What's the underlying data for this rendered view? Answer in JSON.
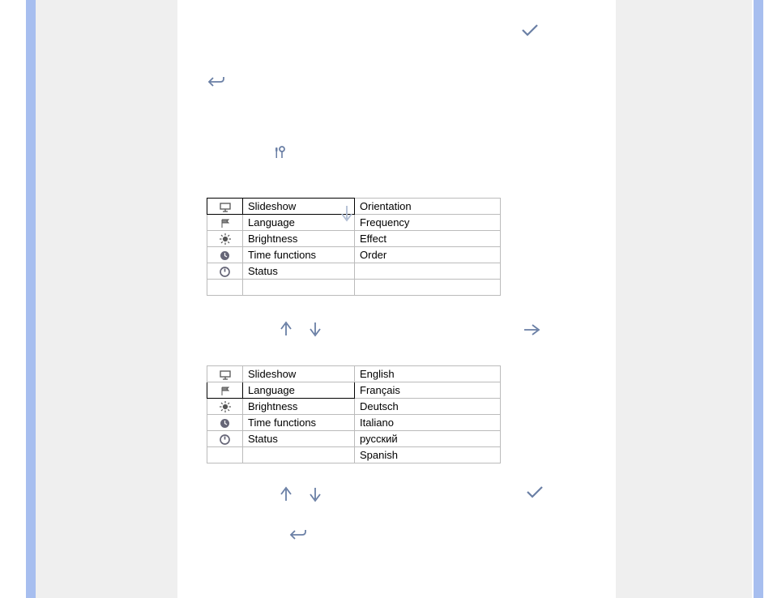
{
  "table1": {
    "selected_index": 0,
    "left": [
      {
        "icon": "slideshow",
        "label": "Slideshow"
      },
      {
        "icon": "flag",
        "label": "Language"
      },
      {
        "icon": "brightness",
        "label": "Brightness"
      },
      {
        "icon": "clock-filled",
        "label": "Time functions"
      },
      {
        "icon": "clock-outline",
        "label": "Status"
      },
      {
        "icon": "",
        "label": ""
      }
    ],
    "right": [
      "Orientation",
      "Frequency",
      "Effect",
      "Order",
      "",
      ""
    ]
  },
  "table2": {
    "selected_index": 1,
    "left": [
      {
        "icon": "slideshow",
        "label": "Slideshow"
      },
      {
        "icon": "flag",
        "label": "Language"
      },
      {
        "icon": "brightness",
        "label": "Brightness"
      },
      {
        "icon": "clock-filled",
        "label": "Time functions"
      },
      {
        "icon": "clock-outline",
        "label": "Status"
      },
      {
        "icon": "",
        "label": ""
      }
    ],
    "right": [
      "English",
      "Français",
      "Deutsch",
      "Italiano",
      "русский",
      "Spanish"
    ]
  },
  "icons": {
    "check": "check-icon",
    "back": "back-icon",
    "tools": "tools-icon",
    "up": "up-arrow-icon",
    "down": "down-arrow-icon",
    "right": "right-arrow-icon"
  }
}
